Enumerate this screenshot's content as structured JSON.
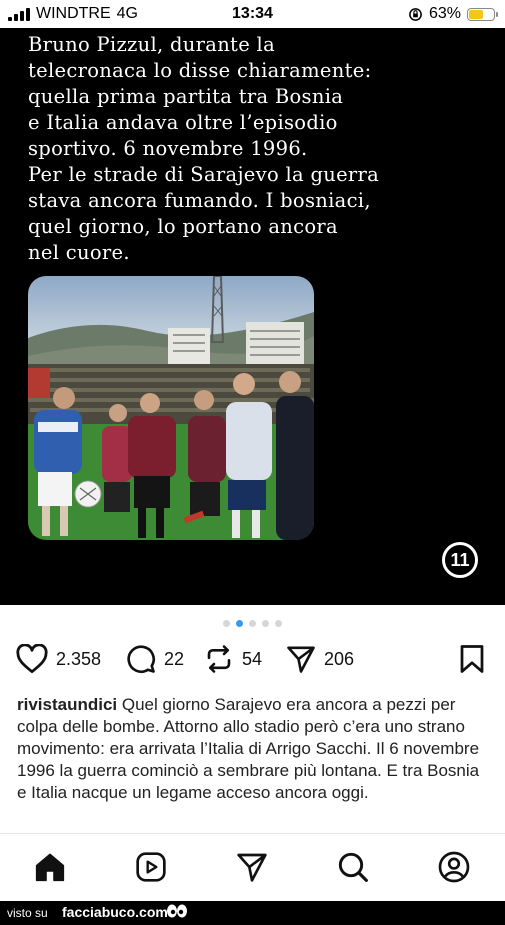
{
  "status_bar": {
    "carrier": "WINDTRE",
    "network": "4G",
    "time": "13:34",
    "battery_percent": "63%",
    "battery_level": 0.63
  },
  "post": {
    "quote_lines": [
      "Bruno Pizzul, durante la",
      "telecronaca lo disse chiaramente:",
      "quella prima partita tra Bosnia",
      "e Italia andava oltre l’episodio",
      "sportivo. 6 novembre 1996.",
      "Per le strade di Sarajevo la guerra",
      "stava ancora fumando. I bosniaci,",
      "quel giorno, lo portano ancora",
      "nel cuore."
    ],
    "brand_mark": "11",
    "carousel": {
      "count": 5,
      "active_index": 1
    }
  },
  "actions": {
    "likes": "2.358",
    "comments": "22",
    "reposts": "54",
    "shares": "206"
  },
  "caption": {
    "username": "rivistaundici",
    "text": "Quel giorno Sarajevo era ancora a pezzi per colpa delle bombe. Attorno allo stadio però c’era uno strano movimento: era arrivata l’Italia di Arrigo Sacchi. Il 6 novembre 1996 la guerra cominciò a sembrare più lontana. E tra Bosnia e Italia nacque un legame acceso ancora oggi."
  },
  "tabs": [
    {
      "icon": "home-icon"
    },
    {
      "icon": "reels-icon"
    },
    {
      "icon": "direct-icon"
    },
    {
      "icon": "search-icon"
    },
    {
      "icon": "profile-icon"
    }
  ],
  "footer": {
    "visto_su": "visto su",
    "site": "facciabuco.com"
  },
  "colors": {
    "accent": "#3897f0",
    "battery": "#f5c518",
    "post_background": "#000000"
  }
}
